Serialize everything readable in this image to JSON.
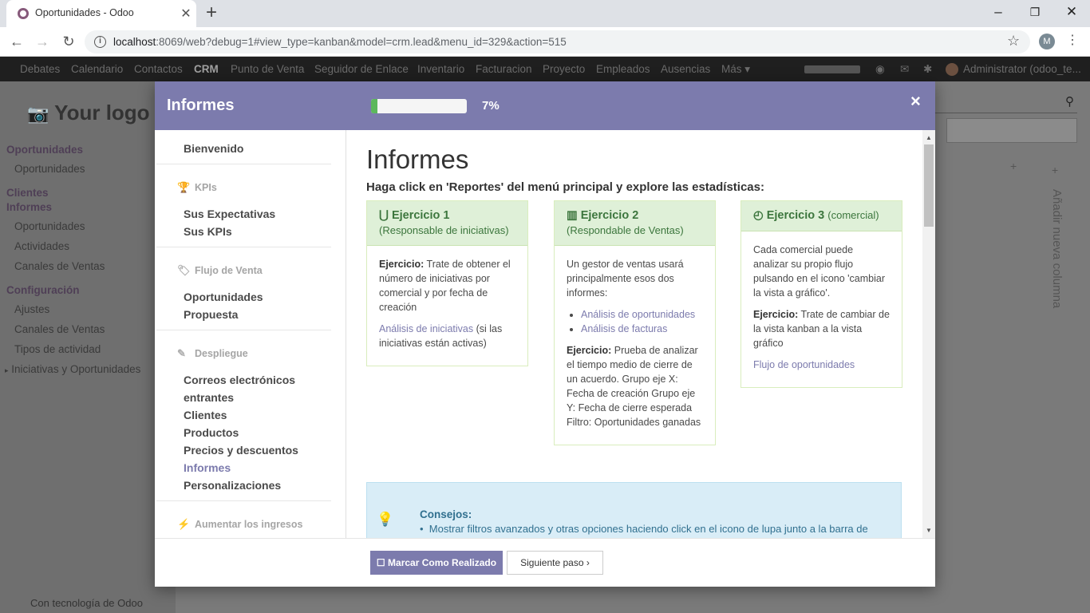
{
  "browser": {
    "tab_title": "Oportunidades - Odoo",
    "url_host": "localhost",
    "url_rest": ":8069/web?debug=1#view_type=kanban&model=crm.lead&menu_id=329&action=515",
    "profile_initial": "M"
  },
  "topbar": {
    "menu": [
      "Debates",
      "Calendario",
      "Contactos",
      "CRM",
      "Punto de Venta",
      "Seguidor de Enlace",
      "Inventario",
      "Facturacion",
      "Proyecto",
      "Empleados",
      "Ausencias",
      "Más"
    ],
    "active": "CRM",
    "user": "Administrator (odoo_te..."
  },
  "sidebar": {
    "logo": "Your logo",
    "sections": [
      {
        "title": "Oportunidades",
        "items": [
          "Oportunidades"
        ]
      },
      {
        "title": "Clientes",
        "items": []
      },
      {
        "title": "Informes",
        "items": [
          "Oportunidades",
          "Actividades",
          "Canales de Ventas"
        ]
      },
      {
        "title": "Configuración",
        "items": [
          "Ajustes",
          "Canales de Ventas",
          "Tipos de actividad",
          "Iniciativas y Oportunidades"
        ]
      }
    ],
    "powered": "Con tecnología de Odoo"
  },
  "kanban": {
    "add_column": "Añadir nueva columna"
  },
  "modal": {
    "title": "Informes",
    "progress_pct": 7,
    "progress_label": "7%",
    "close": "×",
    "left_pane": {
      "welcome": "Bienvenido",
      "sections": [
        {
          "title": "KPIs",
          "icon": "trophy-icon",
          "items": [
            "Sus Expectativas",
            "Sus KPIs"
          ]
        },
        {
          "title": "Flujo de Venta",
          "icon": "tag-icon",
          "items": [
            "Oportunidades",
            "Propuesta"
          ]
        },
        {
          "title": "Despliegue",
          "icon": "magic-wand-icon",
          "items": [
            "Correos electrónicos",
            "entrantes",
            "Clientes",
            "Productos",
            "Precios y descuentos",
            "Informes",
            "Personalizaciones"
          ]
        },
        {
          "title": "Aumentar los ingresos",
          "icon": "bolt-icon",
          "items": []
        }
      ],
      "active_item": "Informes"
    },
    "content": {
      "heading": "Informes",
      "subheading": "Haga click en 'Reportes' del menú principal y explore las estadísticas:",
      "cards": [
        {
          "title": "Ejercicio 1",
          "title_suffix": "",
          "subtitle": "(Responsable de iniciativas)",
          "icon": "magnet-icon",
          "exercise_label": "Ejercicio:",
          "exercise_text": "Trate de obtener el número de iniciativas por comercial y por fecha de creación",
          "link": "Análisis de iniciativas",
          "link_note": "(si las iniciativas están activas)"
        },
        {
          "title": "Ejercicio 2",
          "title_suffix": "",
          "subtitle": "(Respondable de Ventas)",
          "icon": "bar-chart-icon",
          "intro": "Un gestor de ventas usará principalmente esos dos informes:",
          "links": [
            "Análisis de oportunidades",
            "Análisis de facturas"
          ],
          "exercise_label": "Ejercicio:",
          "exercise_text": "Prueba de analizar el tiempo medio de cierre de un acuerdo. Grupo eje X: Fecha de creación Grupo eje Y: Fecha de cierre esperada Filtro: Oportunidades ganadas"
        },
        {
          "title": "Ejercicio 3",
          "title_suffix": "(comercial)",
          "subtitle": "",
          "icon": "history-icon",
          "intro": "Cada comercial puede analizar su propio flujo pulsando en el icono 'cambiar la vista a gráfico'.",
          "exercise_label": "Ejercicio:",
          "exercise_text": "Trate de cambiar de la vista kanban a la vista gráfico",
          "link": "Flujo de oportunidades"
        }
      ],
      "tips_title": "Consejos:",
      "tips_items": [
        "Mostrar filtros avanzados y otras opciones haciendo click en el icono de lupa junto a la barra de"
      ]
    },
    "footer": {
      "done_label": "Marcar Como Realizado",
      "next_label": "Siguiente paso"
    }
  }
}
